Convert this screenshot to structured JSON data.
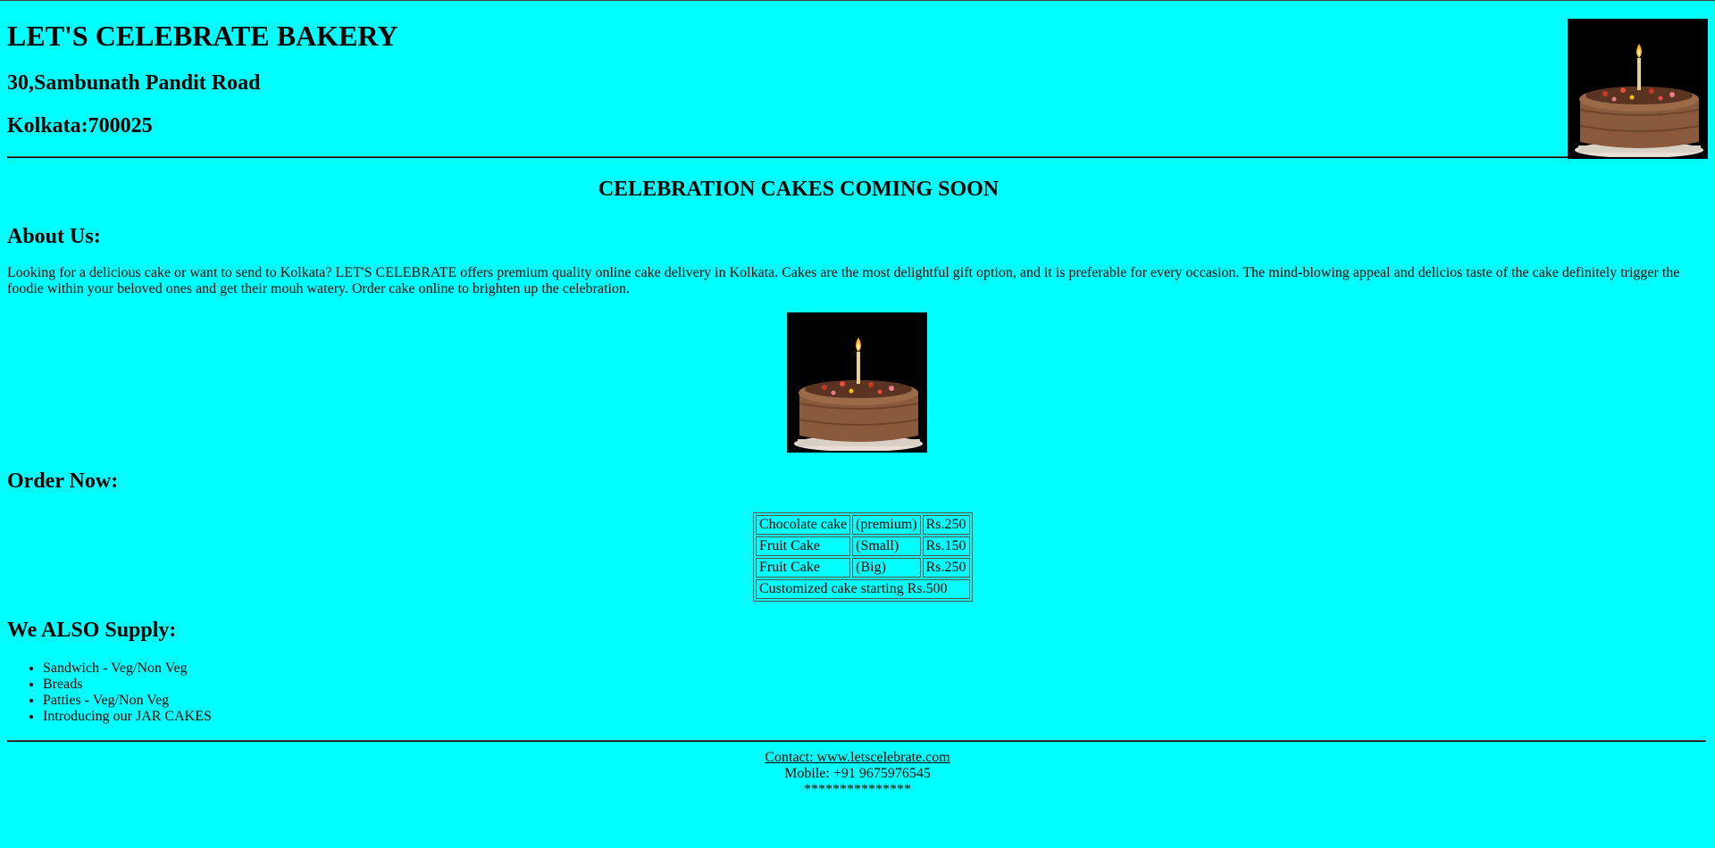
{
  "header": {
    "title": "LET'S CELEBRATE BAKERY",
    "address_line1": "30,Sambunath Pandit Road",
    "address_line2": "Kolkata:700025",
    "logo_icon": "birthday-cake-image"
  },
  "announcement": "CELEBRATION CAKES COMING SOON",
  "about": {
    "heading": "About Us:",
    "text": "Looking for a delicious cake or want to send to Kolkata? LET'S CELEBRATE offers premium quality online cake delivery in Kolkata. Cakes are the most delightful gift option, and it is preferable for every occasion. The mind-blowing appeal and delicios taste of the cake definitely trigger the foodie within your beloved ones and get their mouh watery. Order cake online to brighten up the celebration.",
    "image_icon": "birthday-cake-image"
  },
  "order": {
    "heading": "Order Now:",
    "rows": [
      {
        "item": "Chocolate cake",
        "variant": "(premium)",
        "price": "Rs.250"
      },
      {
        "item": "Fruit Cake",
        "variant": "(Small)",
        "price": "Rs.150"
      },
      {
        "item": "Fruit Cake",
        "variant": "(Big)",
        "price": "Rs.250"
      }
    ],
    "custom_row": "Customized cake starting Rs.500"
  },
  "supply": {
    "heading": "We ALSO Supply:",
    "items": [
      "Sandwich - Veg/Non Veg",
      "Breads",
      "Patties - Veg/Non Veg",
      "Introducing our JAR CAKES"
    ]
  },
  "footer": {
    "contact_link": "Contact: www.letscelebrate.com",
    "mobile": "Mobile: +91 9675976545",
    "stars": "***************"
  },
  "colors": {
    "background": "#00ffff",
    "text": "#000000"
  }
}
